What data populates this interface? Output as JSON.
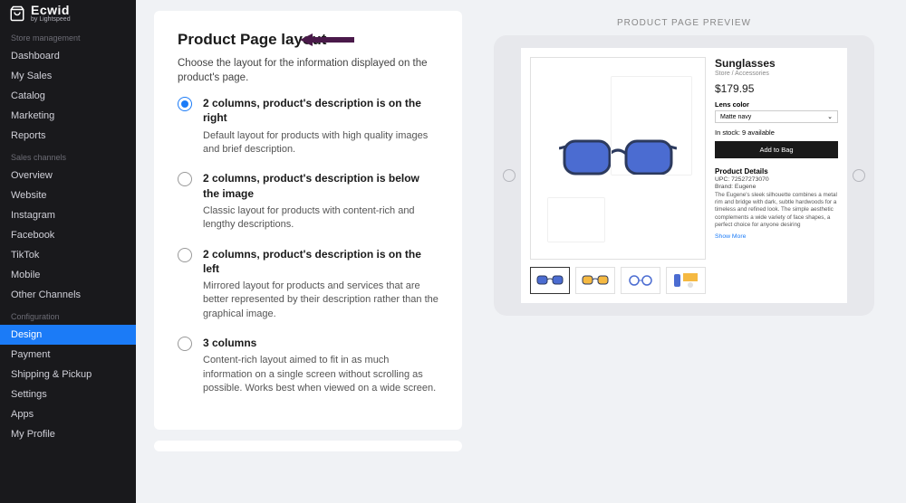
{
  "logo": {
    "main": "Ecwid",
    "sub": "by Lightspeed"
  },
  "sidebar": {
    "sections": [
      {
        "label": "Store management",
        "items": [
          "Dashboard",
          "My Sales",
          "Catalog",
          "Marketing",
          "Reports"
        ]
      },
      {
        "label": "Sales channels",
        "items": [
          "Overview",
          "Website",
          "Instagram",
          "Facebook",
          "TikTok",
          "Mobile",
          "Other Channels"
        ]
      },
      {
        "label": "Configuration",
        "items": [
          "Design",
          "Payment",
          "Shipping & Pickup",
          "Settings",
          "Apps",
          "My Profile"
        ]
      }
    ],
    "active": "Design"
  },
  "card": {
    "title": "Product Page layout",
    "desc": "Choose the layout for the information displayed on the product's page.",
    "options": [
      {
        "title": "2 columns, product's description is on the right",
        "desc": "Default layout for products with high quality images and brief description.",
        "checked": true
      },
      {
        "title": "2 columns, product's description is below the image",
        "desc": "Classic layout for products with content-rich and lengthy descriptions.",
        "checked": false
      },
      {
        "title": "2 columns, product's description is on the left",
        "desc": "Mirrored layout for products and services that are better represented by their description rather than the graphical image.",
        "checked": false
      },
      {
        "title": "3 columns",
        "desc": "Content-rich layout aimed to fit in as much information on a single screen without scrolling as possible. Works best when viewed on a wide screen.",
        "checked": false
      }
    ]
  },
  "preview": {
    "label": "PRODUCT PAGE PREVIEW",
    "product": {
      "title": "Sunglasses",
      "breadcrumb": "Store  /  Accessories",
      "price": "$179.95",
      "attr_label": "Lens color",
      "attr_value": "Matte navy",
      "stock": "In stock: 9 available",
      "bag": "Add to Bag",
      "details_h": "Product Details",
      "upc": "UPC: 72527273070",
      "brand": "Brand: Eugene",
      "long": "The Eugene's sleek silhouette combines a metal rim and bridge with dark, subtle hardwoods for a timeless and refined look. The simple aesthetic complements a wide variety of face shapes, a perfect choice for anyone desiring",
      "show_more": "Show More"
    }
  }
}
